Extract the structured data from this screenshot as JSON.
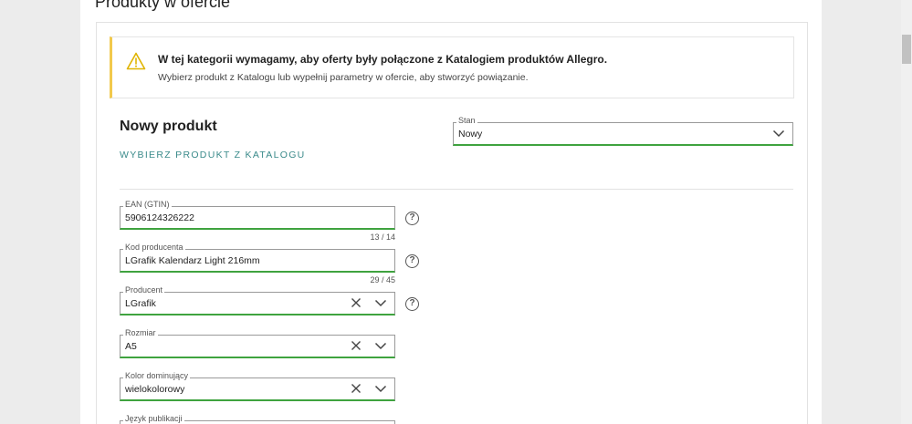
{
  "section": {
    "title": "Produkty w ofercie"
  },
  "alert": {
    "title": "W tej kategorii wymagamy, aby oferty były połączone z Katalogiem produktów Allegro.",
    "text": "Wybierz produkt z Katalogu lub wypełnij parametry w ofercie, aby stworzyć powiązanie.",
    "icon": "warning-icon",
    "accent": "#f2c94c"
  },
  "product": {
    "heading": "Nowy produkt",
    "catalog_link": "WYBIERZ PRODUKT Z KATALOGU"
  },
  "fields": {
    "stan": {
      "label": "Stan",
      "value": "Nowy"
    },
    "ean": {
      "label": "EAN (GTIN)",
      "value": "5906124326222",
      "counter": "13  /  14"
    },
    "kod": {
      "label": "Kod producenta",
      "value": "LGrafik Kalendarz Light 216mm",
      "counter": "29  /  45"
    },
    "producent": {
      "label": "Producent",
      "value": "LGrafik"
    },
    "rozmiar": {
      "label": "Rozmiar",
      "value": "A5"
    },
    "kolor": {
      "label": "Kolor dominujący",
      "value": "wielokolorowy"
    },
    "jezyk": {
      "label": "Język publikacji",
      "value": ""
    }
  },
  "help_symbol": "?",
  "colors": {
    "valid_border": "#3fa33f",
    "link": "#3a8a8a"
  }
}
